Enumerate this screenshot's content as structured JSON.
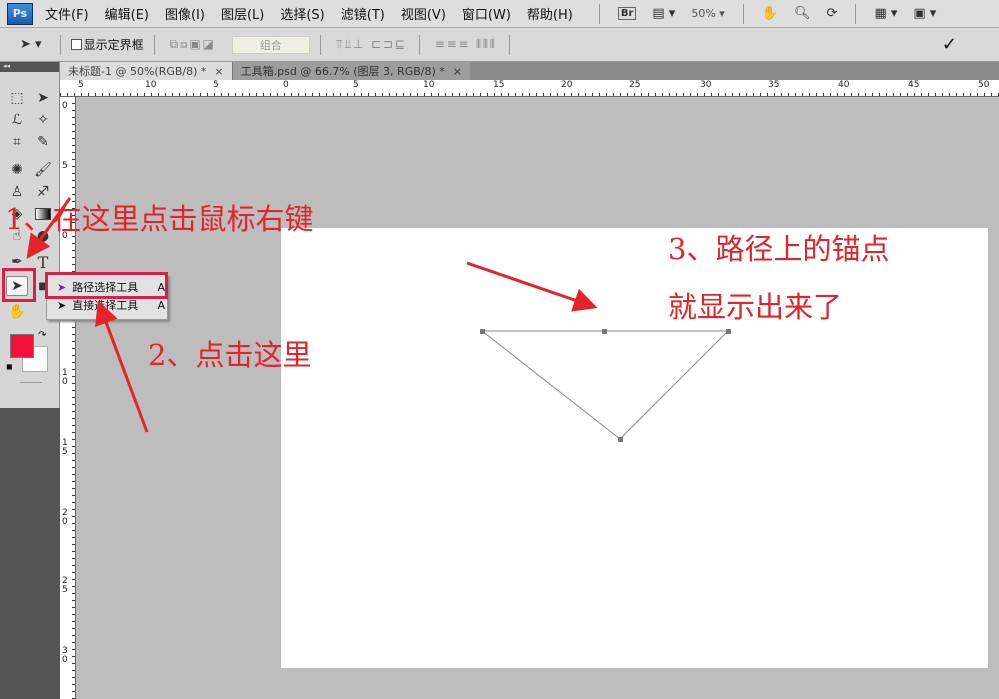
{
  "app": {
    "logo": "Ps"
  },
  "menu": [
    "文件(F)",
    "编辑(E)",
    "图像(I)",
    "图层(L)",
    "选择(S)",
    "滤镜(T)",
    "视图(V)",
    "窗口(W)",
    "帮助(H)"
  ],
  "appbar": {
    "bridge": "Br",
    "zoom": "50%"
  },
  "options": {
    "show_bounding_box": "显示定界框",
    "combine": "组合",
    "commit": "✓"
  },
  "tabs": [
    {
      "label": "未标题-1 @ 50%(RGB/8) *",
      "close": "×"
    },
    {
      "label": "工具箱.psd @ 66.7% (图层 3, RGB/8) *",
      "close": "×"
    }
  ],
  "ruler_top": [
    "5",
    "10",
    "5",
    "0",
    "5",
    "10",
    "15",
    "20",
    "25",
    "30",
    "35",
    "40",
    "45",
    "50"
  ],
  "ruler_left": [
    "0",
    "5",
    "0",
    "5",
    "1\n0",
    "1\n5",
    "2\n0",
    "2\n5",
    "3\n0"
  ],
  "flyout": [
    {
      "label": "路径选择工具",
      "key": "A"
    },
    {
      "label": "直接选择工具",
      "key": "A"
    }
  ],
  "annotations": {
    "step1": "1、在这里点击鼠标右键",
    "step2": "2、点击这里",
    "step3a": "3、路径上的锚点",
    "step3b": "就显示出来了"
  },
  "colors": {
    "foreground": "#f5103c",
    "background": "#ffffff",
    "annotation": "#e3242b"
  }
}
